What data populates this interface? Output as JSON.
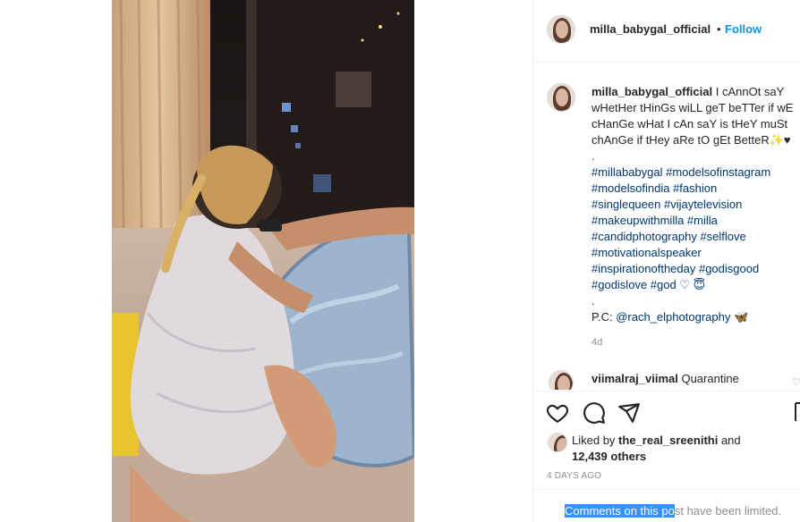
{
  "post": {
    "username": "milla_babygal_official",
    "separator": "•",
    "follow_label": "Follow"
  },
  "caption": {
    "username": "milla_babygal_official",
    "text": "I cAnnOt saY wHetHer tHinGs wiLL geT beTTer if wE cHanGe wHat I cAn saY is tHeY muSt chAnGe if tHey aRe tO gEt BetteR✨♥",
    "dot1": ".",
    "tags": [
      "#millababygal #modelsofinstagram",
      "#modelsofindia #fashion",
      "#singlequeen #vijaytelevision",
      "#makeupwithmilla #milla",
      "#candidphotography #selflove",
      "#motivationalspeaker",
      "#inspirationoftheday #godisgood",
      "#godislove #god ♡ 😇"
    ],
    "dot2": ".",
    "pc_prefix": "P.C: ",
    "pc_mention": "@rach_elphotography",
    "pc_emoji": "🦋",
    "time_ago": "4d"
  },
  "comment": {
    "username": "viimalraj_viimal",
    "text": "Quarantine",
    "heart": "♡"
  },
  "likes": {
    "prefix": "Liked by ",
    "user": "the_real_sreenithi",
    "and": " and",
    "count": "12,439 others"
  },
  "date": "4 DAYS AGO",
  "limited": {
    "selected": "Comments on this po",
    "rest": "st have been limited."
  },
  "icons": {
    "like": "heart-outline-icon",
    "comment": "speech-bubble-icon",
    "share": "paper-plane-icon",
    "save": "bookmark-icon"
  }
}
